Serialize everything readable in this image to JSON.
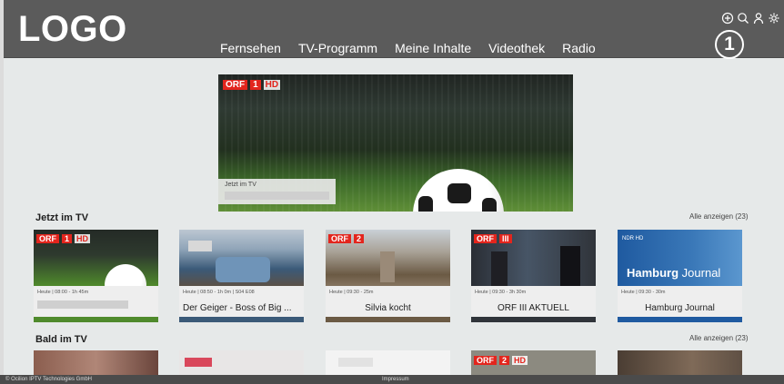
{
  "header": {
    "logo": "LOGO",
    "nav": [
      "Fernsehen",
      "TV-Programm",
      "Meine Inhalte",
      "Videothek",
      "Radio"
    ],
    "tools": [
      "add-circle-icon",
      "search-icon",
      "user-icon",
      "gear-icon"
    ],
    "badge": "1"
  },
  "hero": {
    "channel": "ORF 1 HD",
    "label": "Jetzt im TV"
  },
  "now": {
    "title": "Jetzt im TV",
    "see_all": "Alle anzeigen (23)",
    "cards": [
      {
        "meta": "Heute | 08:00 - 1h 45m",
        "name": "",
        "channel": "ORF 1 HD",
        "strip": "#4f8a2c"
      },
      {
        "meta": "Heute | 08:50 - 1h 0m | S04 E08",
        "name": "Der Geiger - Boss of Big ...",
        "channel": "",
        "strip": "#3b5a78"
      },
      {
        "meta": "Heute | 09:30 - 25m",
        "name": "Silvia kocht",
        "channel": "ORF 2 HD",
        "strip": "#6b5a44"
      },
      {
        "meta": "Heute | 09:30 - 3h 30m",
        "name": "ORF III AKTUELL",
        "channel": "ORF III",
        "strip": "#30343a"
      },
      {
        "meta": "Heute | 09:30 - 30m",
        "name": "Hamburg Journal",
        "channel": "NDR HD",
        "strip": "#1f5aa0"
      }
    ]
  },
  "later": {
    "title": "Bald im TV",
    "see_all": "Alle anzeigen (23)"
  },
  "footer": {
    "copyright": "© Ocilion IPTV Technologies GmbH",
    "impressum": "Impressum"
  }
}
